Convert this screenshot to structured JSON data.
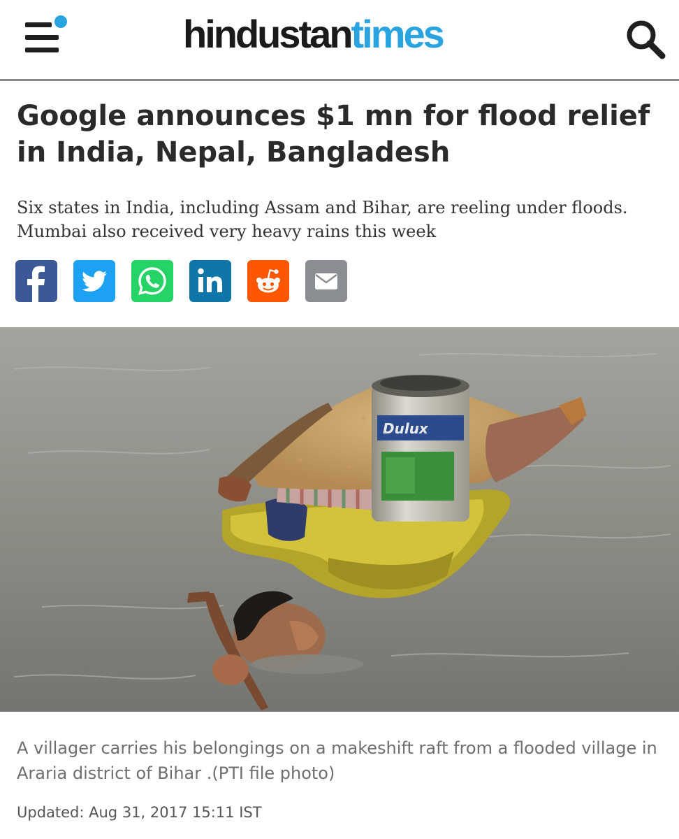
{
  "header": {
    "logo_part1": "hindustan",
    "logo_part2": "times",
    "brand_color": "#2aa4e0",
    "menu_icon": "hamburger-menu-icon",
    "search_icon": "search-icon"
  },
  "article": {
    "headline": "Google announces $1 mn for flood relief in India, Nepal, Bangladesh",
    "subhead": "Six states in India, including Assam and Bihar, are reeling under floods. Mumbai also received very heavy rains this week",
    "share": [
      {
        "icon": "facebook-icon",
        "color": "#3b5998"
      },
      {
        "icon": "twitter-icon",
        "color": "#1da1f2"
      },
      {
        "icon": "whatsapp-icon",
        "color": "#25d366"
      },
      {
        "icon": "linkedin-icon",
        "color": "#0e76a8"
      },
      {
        "icon": "reddit-icon",
        "color": "#ff5700"
      },
      {
        "icon": "email-icon",
        "color": "#8a8d91"
      }
    ],
    "image_caption": "A villager carries his belongings on a makeshift raft from a flooded village in Araria district of Bihar .(PTI file photo)",
    "updated": "Updated: Aug 31, 2017 15:11 IST"
  }
}
